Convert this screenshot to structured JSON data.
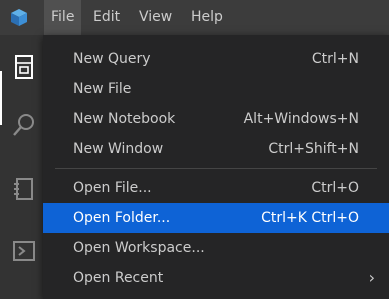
{
  "menubar": {
    "items": [
      {
        "label": "File"
      },
      {
        "label": "Edit"
      },
      {
        "label": "View"
      },
      {
        "label": "Help"
      }
    ],
    "active": "File"
  },
  "activity_bar": {
    "icons": [
      "explorer-icon",
      "search-icon",
      "notebooks-icon",
      "terminal-icon"
    ]
  },
  "file_menu": {
    "groups": [
      [
        {
          "label": "New Query",
          "shortcut": "Ctrl+N"
        },
        {
          "label": "New File",
          "shortcut": ""
        },
        {
          "label": "New Notebook",
          "shortcut": "Alt+Windows+N"
        },
        {
          "label": "New Window",
          "shortcut": "Ctrl+Shift+N"
        }
      ],
      [
        {
          "label": "Open File...",
          "shortcut": "Ctrl+O"
        },
        {
          "label": "Open Folder...",
          "shortcut": "Ctrl+K Ctrl+O",
          "highlighted": true
        },
        {
          "label": "Open Workspace...",
          "shortcut": ""
        },
        {
          "label": "Open Recent",
          "shortcut": "",
          "submenu": true
        }
      ]
    ],
    "submenu_glyph": "›"
  },
  "colors": {
    "titlebar": "#3c3c3c",
    "menu_background": "#252526",
    "highlight": "#0e63d6",
    "text": "#cccccc"
  }
}
